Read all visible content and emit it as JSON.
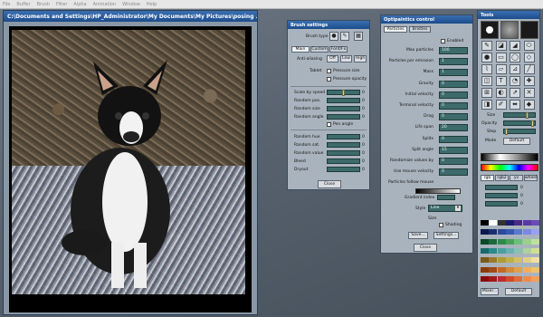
{
  "menubar": {
    "items": [
      "File",
      "Buffer",
      "Brush",
      "Filter",
      "Alpha",
      "Animation",
      "Window",
      "Help"
    ]
  },
  "image_window": {
    "title": "C:\\Documents and Settings\\HP_Administrator\\My Documents\\My Pictures\\posing .jpg"
  },
  "brush_settings": {
    "title": "Brush settings",
    "brush_type_label": "Brush type",
    "tabs": [
      "Main",
      "Custom",
      "Font/Fx"
    ],
    "anti_aliasing_label": "Anti-aliasing",
    "aa_options": [
      "Off",
      "Low",
      "High"
    ],
    "tablet_label": "Tablet",
    "pressure_size": "Pressure size",
    "pressure_opacity": "Pressure opacity",
    "sliders": [
      {
        "label": "Scale by speed",
        "value": "0"
      },
      {
        "label": "Random pos.",
        "value": "0"
      },
      {
        "label": "Random size",
        "value": "0"
      },
      {
        "label": "Random angle",
        "value": "0"
      }
    ],
    "pen_angle": "Pen angle",
    "sliders2": [
      {
        "label": "Random hue",
        "value": "0"
      },
      {
        "label": "Random sat.",
        "value": "0"
      },
      {
        "label": "Random value",
        "value": "0"
      },
      {
        "label": "Bleed",
        "value": "0"
      },
      {
        "label": "Dryout",
        "value": "0"
      }
    ],
    "close": "Close"
  },
  "opti": {
    "title": "Optipaintics control",
    "tabs": [
      "Particles",
      "Bristles"
    ],
    "enabled": "Enabled",
    "rows": [
      {
        "label": "Max particles",
        "value": "100"
      },
      {
        "label": "Particles per emission",
        "value": "1"
      },
      {
        "label": "Mass",
        "value": "1"
      },
      {
        "label": "Gravity",
        "value": "0"
      },
      {
        "label": "Initial velocity",
        "value": "0"
      },
      {
        "label": "Terminal velocity",
        "value": "0"
      },
      {
        "label": "Drag",
        "value": "0"
      },
      {
        "label": "Life span",
        "value": "20"
      },
      {
        "label": "Splits",
        "value": "0"
      },
      {
        "label": "Split angle",
        "value": "15"
      },
      {
        "label": "Randomize values by",
        "value": "0"
      },
      {
        "label": "Use mouse velocity",
        "value": "0"
      }
    ],
    "follow_mouse": "Particles follow mouse",
    "gradient_index": "Gradient index",
    "style_label": "Style",
    "style_value": "Line",
    "size_label": "Size",
    "shading": "Shading",
    "save": "Save...",
    "settings": "Settings...",
    "close": "Close"
  },
  "tools": {
    "title": "Tools",
    "size_label": "Size",
    "opacity_label": "Opacity",
    "step_label": "Step",
    "mode_label": "Mode",
    "mode_value": "Default",
    "color_tabs": [
      "rgb",
      "rgb2",
      "yv",
      "wheel"
    ],
    "rgb_values": [
      "0",
      "0",
      "0"
    ],
    "mixer": "Mixer...",
    "default": "Default"
  }
}
